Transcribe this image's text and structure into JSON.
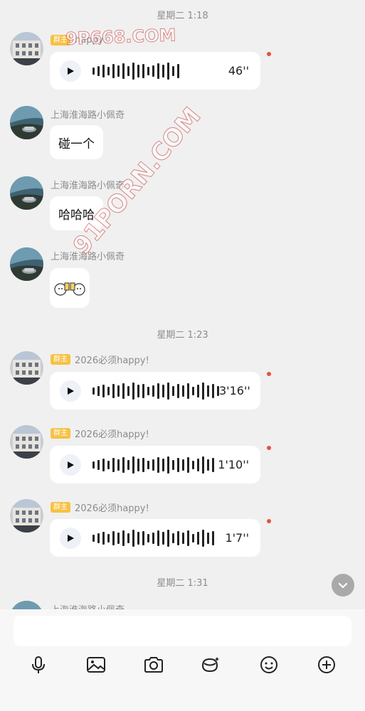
{
  "watermarks": [
    "9P668.COM",
    "91PORN.COM"
  ],
  "timestamps": [
    "星期二 1:18",
    "星期二 1:23",
    "星期二 1:31"
  ],
  "messages": [
    {
      "name": "happy!",
      "badge": "群主",
      "type": "voice",
      "duration": "46''",
      "unread": true
    },
    {
      "name": "上海淮海路小佩奇",
      "type": "text",
      "text": "碰一个"
    },
    {
      "name": "上海淮海路小佩奇",
      "type": "text",
      "text": "哈哈哈"
    },
    {
      "name": "上海淮海路小佩奇",
      "type": "sticker"
    },
    {
      "name": "2026必须happy!",
      "badge": "群主",
      "type": "voice",
      "duration": "3'16''",
      "unread": true
    },
    {
      "name": "2026必须happy!",
      "badge": "群主",
      "type": "voice",
      "duration": "1'10''",
      "unread": true
    },
    {
      "name": "2026必须happy!",
      "badge": "群主",
      "type": "voice",
      "duration": "1'7''",
      "unread": true
    },
    {
      "name": "上海淮海路小佩奇",
      "type": "partial"
    }
  ],
  "input": {
    "placeholder": ""
  },
  "toolbar": [
    "microphone-icon",
    "image-icon",
    "camera-icon",
    "red-packet-icon",
    "emoji-icon",
    "plus-icon"
  ],
  "colors": {
    "unread_dot": "#e8513f",
    "badge": "#f6c244",
    "background": "#f0f0f0"
  }
}
